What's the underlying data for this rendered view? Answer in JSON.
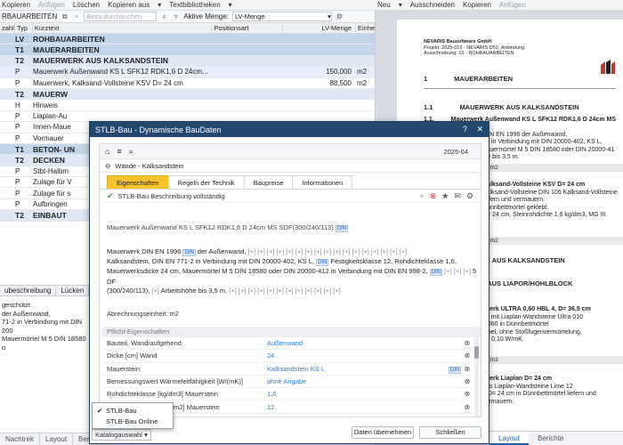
{
  "toolbar_left": {
    "items": [
      "Kopieren",
      "Anfügen",
      "Löschen",
      "Kopieren aus",
      "Textbibliotheken"
    ]
  },
  "toolbar_right": {
    "items": [
      "Neu",
      "Ausschneiden",
      "Kopieren",
      "Anfügen"
    ]
  },
  "left_header": {
    "title": "RBAUARBEITEN",
    "search_placeholder": "Bezu durchsuchen",
    "active_label": "Aktive Menge:",
    "active_value": "LV-Menge"
  },
  "columns": [
    "zahl",
    "Typ",
    "Kurztext",
    "Positionsart",
    "LV-Menge",
    "Einheit"
  ],
  "rows": [
    {
      "type": "lv",
      "c1": "",
      "c2": "LV",
      "text": "ROHBAUARBEITEN",
      "qty": "",
      "unit": ""
    },
    {
      "type": "t1",
      "c1": "",
      "c2": "T1",
      "text": "MAUERARBEITEN",
      "qty": "",
      "unit": ""
    },
    {
      "type": "t2",
      "c1": "",
      "c2": "T2",
      "text": "MAUERWERK AUS KALKSANDSTEIN",
      "qty": "",
      "unit": ""
    },
    {
      "type": "sel1",
      "c1": "",
      "c2": "P",
      "text": "Mauerwerk Außenwand KS L SFK12 RDK1,6 D 24cm...",
      "qty": "150,000",
      "unit": "m2"
    },
    {
      "type": "pos",
      "c1": "",
      "c2": "P",
      "text": "Mauerwerk, Kalksand-Vollsteine KSV D= 24 cm",
      "qty": "88,500",
      "unit": "m2"
    },
    {
      "type": "t2",
      "c1": "",
      "c2": "T2",
      "text": "MAUERW",
      "qty": "",
      "unit": ""
    },
    {
      "type": "pos",
      "c1": "",
      "c2": "H",
      "text": "Hinweis",
      "qty": "",
      "unit": ""
    },
    {
      "type": "pos",
      "c1": "",
      "c2": "P",
      "text": "Liaplan-Au",
      "qty": "",
      "unit": ""
    },
    {
      "type": "pos",
      "c1": "",
      "c2": "P",
      "text": "Innen-Maue",
      "qty": "",
      "unit": ""
    },
    {
      "type": "pos",
      "c1": "",
      "c2": "P",
      "text": "Vormauer",
      "qty": "",
      "unit": ""
    },
    {
      "type": "t1",
      "c1": "",
      "c2": "T1",
      "text": "BETON- UN",
      "qty": "",
      "unit": ""
    },
    {
      "type": "t2",
      "c1": "",
      "c2": "T2",
      "text": "DECKEN",
      "qty": "",
      "unit": ""
    },
    {
      "type": "pos",
      "c1": "",
      "c2": "P",
      "text": "Stbt-Halbm",
      "qty": "",
      "unit": ""
    },
    {
      "type": "pos",
      "c1": "",
      "c2": "P",
      "text": "Zulage für V",
      "qty": "",
      "unit": ""
    },
    {
      "type": "pos",
      "c1": "",
      "c2": "P",
      "text": "Zulage für s",
      "qty": "",
      "unit": ""
    },
    {
      "type": "pos",
      "c1": "",
      "c2": "P",
      "text": "Aufbringen",
      "qty": "",
      "unit": ""
    },
    {
      "type": "t2",
      "c1": "",
      "c2": "T2",
      "text": "EINBAUT",
      "qty": "",
      "unit": ""
    }
  ],
  "left_tabs": [
    "ubeschreibung",
    "Lücken",
    "Pa"
  ],
  "left_desc": [
    "geschützt",
    "der Außenwand,",
    "71-2 in Verbindung mit DIN 200",
    "Mauermörtel M 5 DIN 18580 o"
  ],
  "left_bottom_tabs": [
    "Nachtrek",
    "Layout",
    "Beri"
  ],
  "document": {
    "firm_name": "NEVARIS Bausoftware GmbH",
    "firm_rows": [
      "Projekt:    2025-019 - NEVARIS D50_Anbindung",
      "Ausschreibung:   01 - ROHBAUARBEITEN"
    ],
    "head1_no": "1",
    "head1_text": "MAUERARBEITEN",
    "head2_no": "1.1",
    "head2_text": "MAUERWERK AUS KALKSANDSTEIN",
    "item1_no": "1.1. 10",
    "item1_title": "Mauerwerk Außenwand KS L SFK12 RDK1,6 D 24cm MS SDF(3",
    "item1_lines": [
      "Mauerwerk DIN EN 1996 der Außenwand,",
      "DIN EN 771-2 in Verbindung mit DIN 20000-402, KS L,",
      "D= 24 cm, Mauermörtel M 5 DIN 18580 oder DIN 20000-41",
      "1, Arbeitshöhe bis 3,5 m."
    ],
    "qty1": "000 m2",
    "item2_title": "Kalksand-Vollsteine KSV D= 24 cm",
    "item2_lines": [
      "Kalksand-Vollsteine DIN 106 Kalksand-Vollsteine",
      "liefern und vermauern.",
      "Dünnbettmörtel geklebt.",
      "D= 24 cm, Steinrohdichte 1,6 kg/dm3, MG III."
    ],
    "qty2": "500 m2",
    "head3_text": "RK AUS KALKSANDSTEIN",
    "head4_text": "K AUS LIAPOR/HOHLBLOCK",
    "item3_title": "rwerk ULTRA 0,60 HBL 4, D= 36,5 cm",
    "item3_lines": [
      "rk. mit Liaplan-Wandsteine Ultra 010",
      "4/060 in Dünnbettmörtel",
      "tapel, ohne Stoßfugenvermörtelung,",
      "ert 0,10 W/mK."
    ],
    "qty3": "000 m3",
    "item4_title": "rwerk Liaplan D= 24 cm",
    "item4_lines": [
      "aus Liaplan-Wandsteine Lime 12",
      "n D= 24 cm in Dünnbettmörtel liefern und vermauern."
    ],
    "qty4": "",
    "right_tabs": [
      "Layout",
      "Berichte"
    ]
  },
  "dialog": {
    "title": "STLB-Bau - Dynamische BauDaten",
    "date": "2025-04",
    "breadcrumb": "Wände - Kalksandstein",
    "tabs": [
      "Eigenschaften",
      "Regeln der Technik",
      "Baupreise",
      "Informationen"
    ],
    "status": "STLB-Bau Beschreibung vollständig",
    "short_text": "Mauerwerk Außenwand KS L SFK12 RDK1,6 D 24cm MS SDF(300/240/113)",
    "long_text_lines": [
      "Mauerwerk DIN EN 1996",
      "der Außenwand,",
      "Kalksandstein, DIN EN 771-2 in Verbindung mit DIN 20000-402, KS L,",
      "Festigkeitsklasse 12, Rohdichteklasse 1,6,",
      "Mauerwerksdicke 24 cm, Mauermörtel M 5 DIN 18580 oder DIN 20000-412 in Verbindung mit DIN EN 998-2,",
      "5 DF",
      "(300/240/113),",
      "Arbeitshöhe bis 3,5 m."
    ],
    "din_tag": "DIN",
    "unit_label": "Abrechnungseinheit: m2",
    "prop_header": "Pflicht-Eigenschaften",
    "properties": [
      {
        "name": "Bauteil, Wand/aufgehend",
        "value": "Außenwand",
        "tag": ""
      },
      {
        "name": "Dicke [cm] Wand",
        "value": "24",
        "tag": ""
      },
      {
        "name": "Mauerstein",
        "value": "Kalksandstein KS L",
        "tag": "DIN"
      },
      {
        "name": "Bemessungswert Wärmeleitfähigkeit [W/(mK)]",
        "value": "ohne Angabe",
        "tag": ""
      },
      {
        "name": "Rohdichteklasse [kg/dm3] Mauerstein",
        "value": "1,6",
        "tag": ""
      },
      {
        "name": "Festigkeitsklasse [N/mm2] Mauerstein",
        "value": "12",
        "tag": ""
      }
    ],
    "katalog_label": "Katalogauswahl",
    "popup_items": [
      "STLB-Bau",
      "STLB-Bau Online"
    ],
    "btn_apply": "Daten übernehmen",
    "btn_close": "Schließen"
  },
  "colors": {
    "title_bar": "#24476f",
    "tab_active": "#f6c230",
    "value_blue": "#2a7bd6",
    "row_header": "#c3d5ea"
  }
}
